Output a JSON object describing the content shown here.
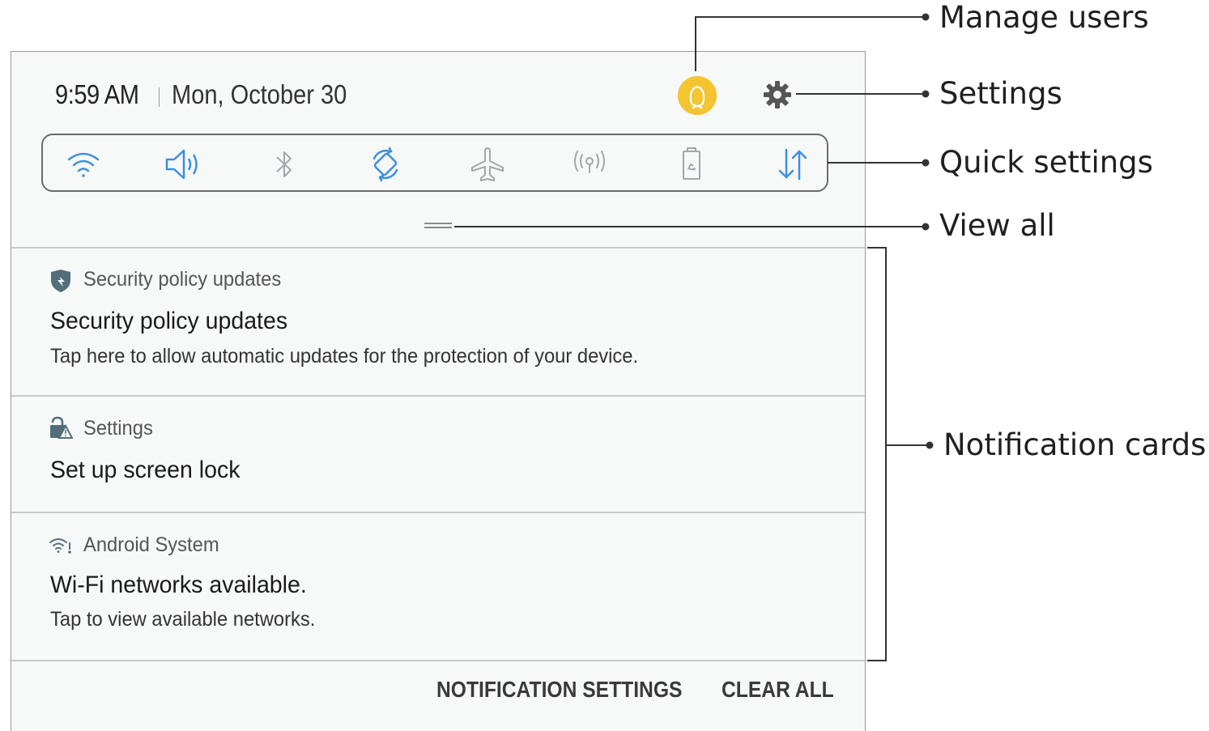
{
  "status_bar": {
    "time": "9:59 AM",
    "date": "Mon, October 30"
  },
  "quick_settings": {
    "icons": [
      "wifi-icon",
      "sound-icon",
      "bluetooth-icon",
      "auto-rotate-icon",
      "airplane-mode-icon",
      "mobile-hotspot-icon",
      "power-saving-icon",
      "mobile-data-icon"
    ],
    "active_color": "#3d8fe0",
    "inactive_color": "#a3a7ab"
  },
  "notifications": [
    {
      "app": "Security policy updates",
      "title": "Security policy updates",
      "text": "Tap here to allow automatic updates for the protection of your device."
    },
    {
      "app": "Settings",
      "title": "Set up screen lock",
      "text": ""
    },
    {
      "app": "Android System",
      "title": "Wi-Fi networks available.",
      "text": "Tap to view available networks."
    }
  ],
  "footer": {
    "notification_settings": "NOTIFICATION SETTINGS",
    "clear_all": "CLEAR ALL"
  },
  "callouts": {
    "manage_users": "Manage users",
    "settings": "Settings",
    "quick_settings": "Quick settings",
    "view_all": "View all",
    "notification_cards": "Notification cards"
  },
  "colors": {
    "avatar": "#f4c431",
    "panel_background": "#f7f8f8"
  }
}
